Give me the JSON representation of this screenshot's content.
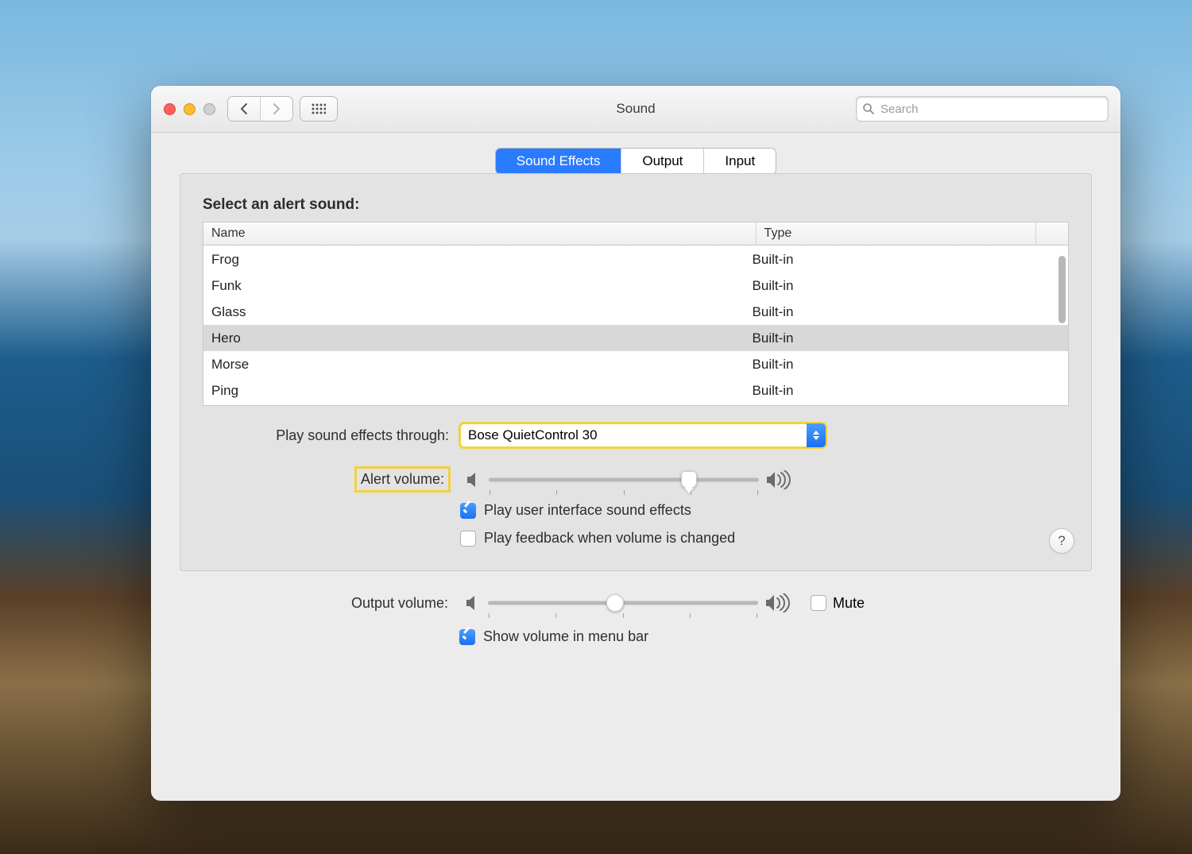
{
  "window": {
    "title": "Sound"
  },
  "search": {
    "placeholder": "Search",
    "value": ""
  },
  "tabs": [
    {
      "label": "Sound Effects",
      "active": true
    },
    {
      "label": "Output",
      "active": false
    },
    {
      "label": "Input",
      "active": false
    }
  ],
  "section_label": "Select an alert sound:",
  "columns": {
    "name": "Name",
    "type": "Type"
  },
  "sounds": [
    {
      "name": "Frog",
      "type": "Built-in",
      "selected": false
    },
    {
      "name": "Funk",
      "type": "Built-in",
      "selected": false
    },
    {
      "name": "Glass",
      "type": "Built-in",
      "selected": false
    },
    {
      "name": "Hero",
      "type": "Built-in",
      "selected": true
    },
    {
      "name": "Morse",
      "type": "Built-in",
      "selected": false
    },
    {
      "name": "Ping",
      "type": "Built-in",
      "selected": false
    }
  ],
  "play_through": {
    "label": "Play sound effects through:",
    "value": "Bose QuietControl 30"
  },
  "alert_volume": {
    "label": "Alert volume:",
    "value": 0.74
  },
  "checkboxes": {
    "ui_sounds": {
      "label": "Play user interface sound effects",
      "checked": true
    },
    "feedback": {
      "label": "Play feedback when volume is changed",
      "checked": false
    }
  },
  "output_volume": {
    "label": "Output volume:",
    "value": 0.47
  },
  "mute": {
    "label": "Mute",
    "checked": false
  },
  "menubar": {
    "label": "Show volume in menu bar",
    "checked": true
  },
  "help": "?"
}
